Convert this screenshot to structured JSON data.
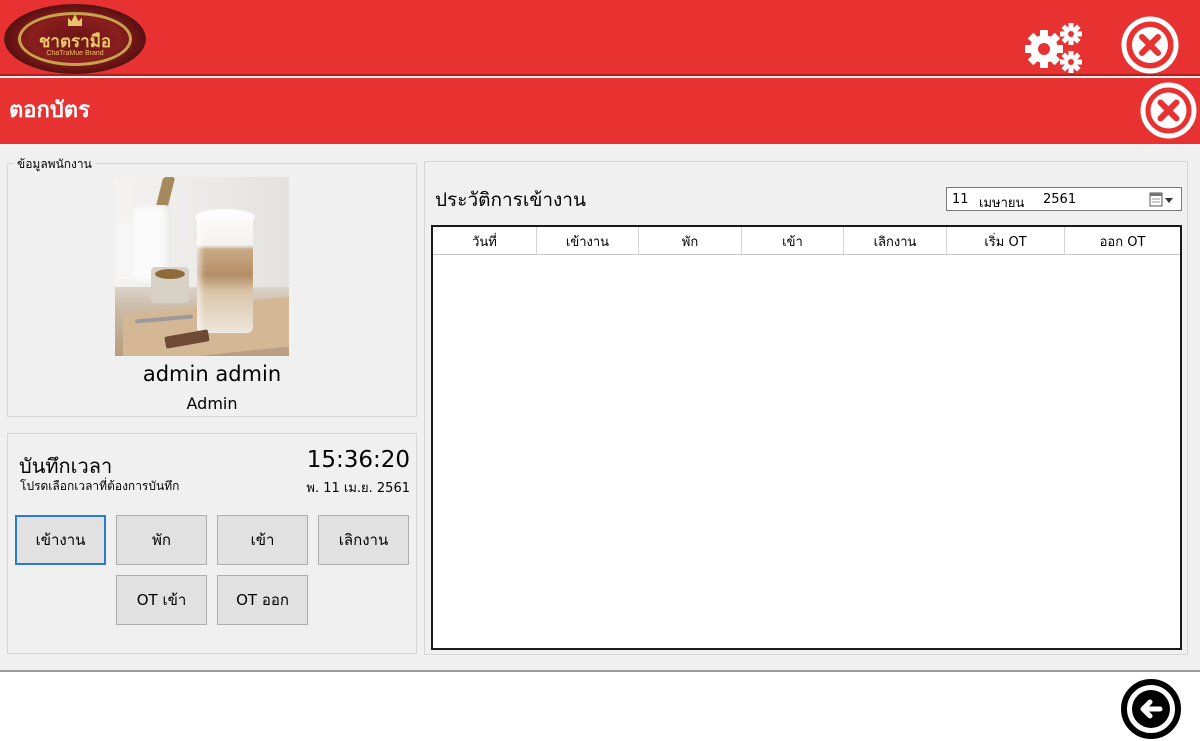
{
  "header": {
    "logo_alt": "ChaTraMue",
    "logo_text": "ชาตรามือ",
    "logo_subtext": "ChaTraMue Brand",
    "settings_icon": "gear-icon",
    "close_icon": "close-icon"
  },
  "window": {
    "title": "ตอกบัตร",
    "close_icon": "close-icon"
  },
  "employee": {
    "legend": "ข้อมูลพนักงาน",
    "name": "admin admin",
    "role": "Admin"
  },
  "time_record": {
    "title": "บันทึกเวลา",
    "subtitle": "โปรดเลือกเวลาที่ต้องการบันทึก",
    "clock": "15:36:20",
    "date": "พ. 11 เม.ย. 2561",
    "buttons": {
      "check_in": "เข้างาน",
      "break": "พัก",
      "enter": "เข้า",
      "check_out": "เลิกงาน",
      "ot_in": "OT เข้า",
      "ot_out": "OT ออก"
    }
  },
  "history": {
    "title": "ประวัติการเข้างาน",
    "date_picker": {
      "day": "11",
      "month": "เมษายน",
      "year": "2561",
      "icon": "calendar-dropdown-icon"
    },
    "columns": [
      "วันที่",
      "เข้างาน",
      "พัก",
      "เข้า",
      "เลิกงาน",
      "เริ่ม OT",
      "ออก OT"
    ],
    "rows": []
  },
  "footer": {
    "back_icon": "back-arrow-icon"
  },
  "colors": {
    "header_red": "#e83232",
    "focus_blue": "#2a7bd0"
  }
}
